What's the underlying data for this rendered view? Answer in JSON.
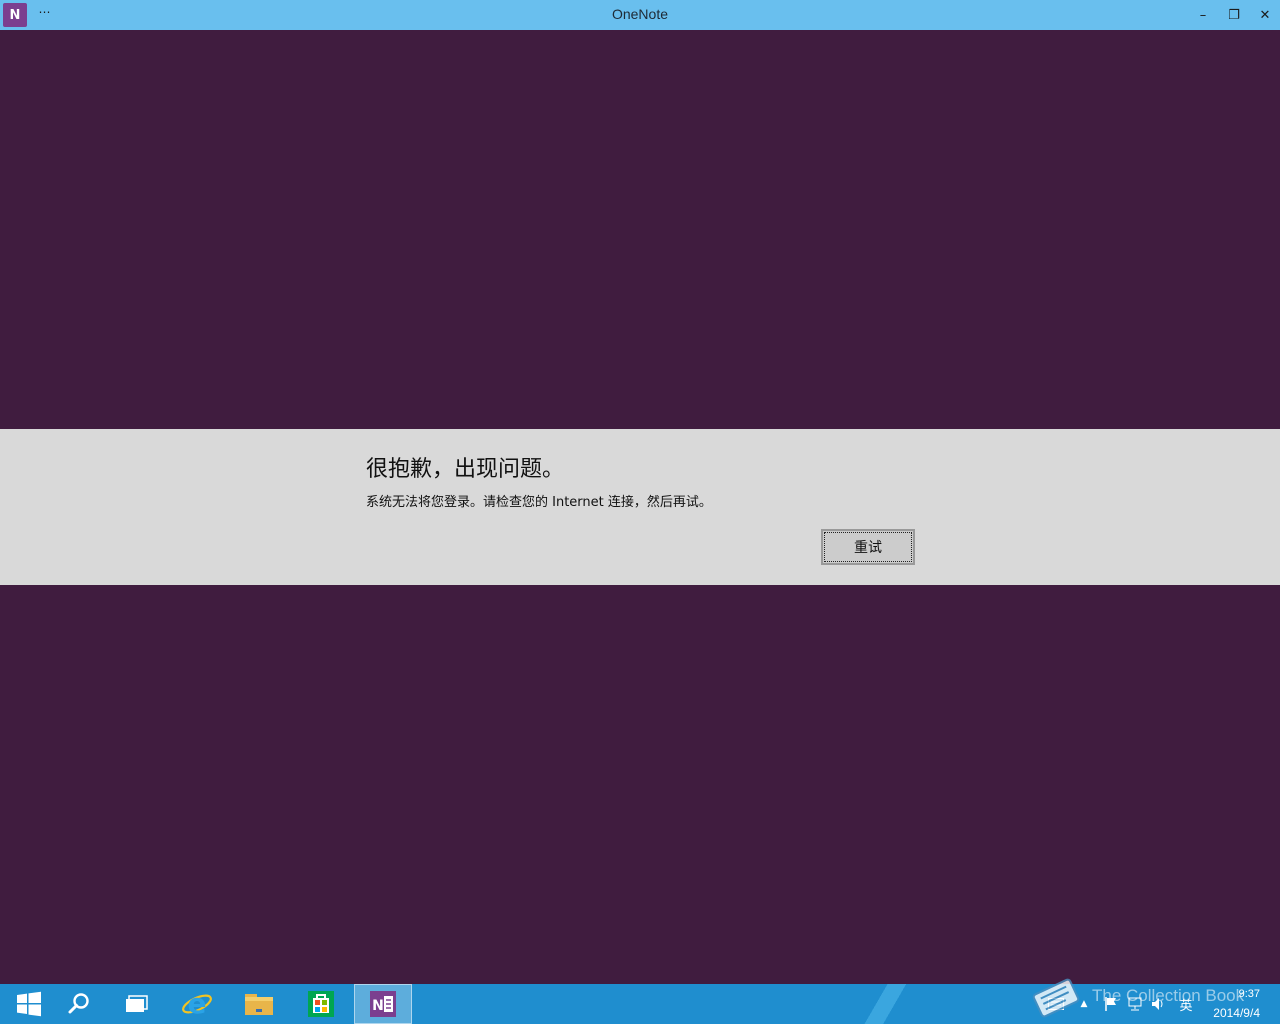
{
  "window": {
    "title": "OneNote",
    "app_icon_label": "N",
    "menu_label": "⋯",
    "minimize": "–",
    "maximize": "❐",
    "close": "✕"
  },
  "error": {
    "title": "很抱歉，出现问题。",
    "message": "系统无法将您登录。请检查您的 Internet 连接，然后再试。",
    "retry_label": "重试"
  },
  "taskbar": {
    "apps": [
      {
        "name": "start",
        "icon": "windows-logo-icon"
      },
      {
        "name": "search",
        "icon": "search-icon"
      },
      {
        "name": "task-view",
        "icon": "task-view-icon"
      },
      {
        "name": "internet-explorer",
        "icon": "ie-icon"
      },
      {
        "name": "file-explorer",
        "icon": "folder-icon"
      },
      {
        "name": "store",
        "icon": "store-icon"
      },
      {
        "name": "onenote",
        "icon": "onenote-icon",
        "active": true
      }
    ],
    "tray": {
      "language": "英",
      "time": "9:37",
      "date": "2014/9/4"
    },
    "watermark": "The Collection Book"
  },
  "colors": {
    "background": "#401c3f",
    "titlebar": "#69bfee",
    "error_band": "#d9d9d9",
    "taskbar": "#1f8ecf",
    "onenote_purple": "#7b3f8f"
  }
}
